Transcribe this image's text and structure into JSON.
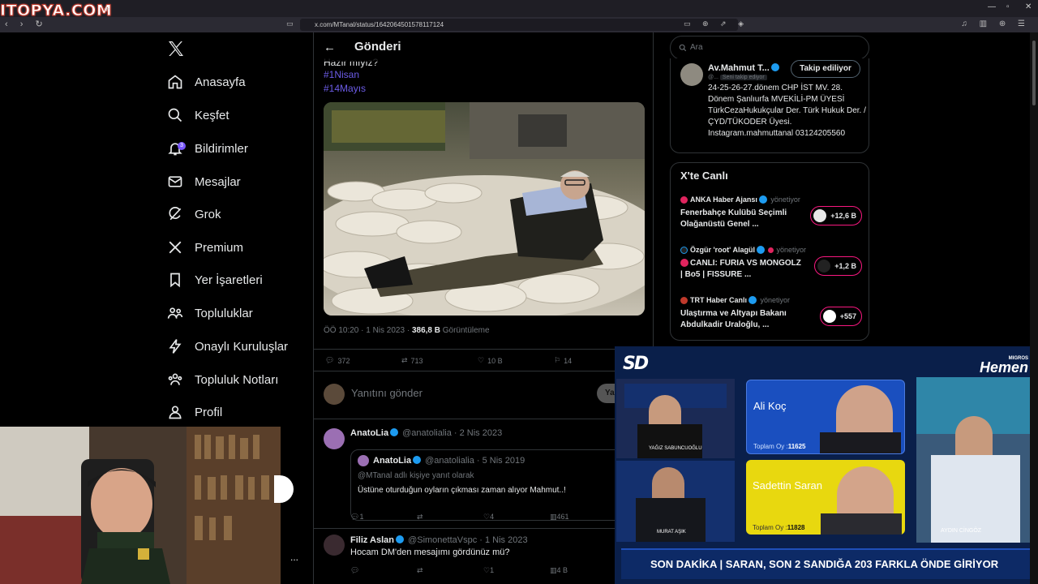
{
  "browser": {
    "watermark": "ITOPYA.COM",
    "new_tab": "+",
    "url": "x.com/MTanal/status/1642064501578117124",
    "window_controls": [
      "—",
      "▫",
      "✕"
    ]
  },
  "nav": {
    "items": [
      {
        "label": "Anasayfa",
        "icon": "home-icon"
      },
      {
        "label": "Keşfet",
        "icon": "search-icon"
      },
      {
        "label": "Bildirimler",
        "icon": "bell-icon",
        "badge": "3"
      },
      {
        "label": "Mesajlar",
        "icon": "mail-icon"
      },
      {
        "label": "Grok",
        "icon": "grok-icon"
      },
      {
        "label": "Premium",
        "icon": "x-icon"
      },
      {
        "label": "Yer İşaretleri",
        "icon": "bookmark-icon"
      },
      {
        "label": "Topluluklar",
        "icon": "communities-icon"
      },
      {
        "label": "Onaylı Kuruluşlar",
        "icon": "lightning-icon"
      },
      {
        "label": "Topluluk Notları",
        "icon": "community-notes-icon"
      },
      {
        "label": "Profil",
        "icon": "profile-icon"
      }
    ],
    "more": "..."
  },
  "post": {
    "header_title": "Gönderi",
    "cut_text": "Hazır mıyız?",
    "hashtags": [
      "#1Nisan",
      "#14Mayıs"
    ],
    "time": "ÖÖ 10:20",
    "date": "1 Nis 2023",
    "views": "386,8 B",
    "views_label": "Görüntüleme",
    "stats": {
      "replies": "372",
      "reposts": "713",
      "likes": "10 B",
      "bookmarks": "14"
    },
    "reply_placeholder": "Yanıtını gönder",
    "reply_button": "Yanıtla"
  },
  "replies": [
    {
      "name": "AnatoLia",
      "handle": "@anatolialia",
      "date": "2 Nis 2023",
      "quote": {
        "name": "AnatoLia",
        "handle": "@anatolialia",
        "date": "5 Nis 2019",
        "reply_to": "@MTanal adlı kişiye yanıt olarak",
        "text": "Üstüne oturduğun oyların çıkması zaman alıyor Mahmut..!"
      },
      "replies": "1",
      "likes": "4",
      "views": "461"
    },
    {
      "name": "Filiz Aslan",
      "handle": "@SimonettaVspc",
      "date": "1 Nis 2023",
      "text": "Hocam DM'den mesajımı gördünüz mü?",
      "replies": "",
      "likes": "1",
      "views": "4 B"
    }
  ],
  "right": {
    "search_placeholder": "Ara",
    "profile": {
      "name": "Av.Mahmut T...",
      "handle": "@...",
      "follows_you": "Seni takip ediyor",
      "follow_button": "Takip ediliyor",
      "bio": "24-25-26-27.dönem CHP İST MV. 28. Dönem Şanlıurfa MVEKİLİ-PM ÜYESİ TürkCezaHukukçular Der. Türk Hukuk Der. /ÇYD/TÜKODER Üyesi. Instagram.mahmuttanal 03124205560"
    },
    "live": {
      "title": "X'te Canlı",
      "items": [
        {
          "source": "ANKA Haber Ajansı",
          "role": "yönetiyor",
          "text": "Fenerbahçe Kulübü Seçimli Olağanüstü Genel ...",
          "count": "+12,6 B"
        },
        {
          "source": "Özgür 'root' Alagül",
          "role": "yönetiyor",
          "text": "CANLI: FURIA VS MONGOLZ | Bo5 | FISSURE ...",
          "count": "+1,2 B"
        },
        {
          "source": "TRT Haber Canlı",
          "role": "yönetiyor",
          "text": "Ulaştırma ve Altyapı Bakanı Abdulkadir Uraloğlu, ...",
          "count": "+557"
        }
      ]
    }
  },
  "stream": {
    "logo": "SD",
    "sponsor_small": "MIGROS",
    "sponsor_big": "Hemen",
    "candidates": [
      {
        "name": "Ali Koç",
        "vote_label": "Toplam Oy :",
        "votes": "11625"
      },
      {
        "name": "Sadettin Saran",
        "vote_label": "Toplam Oy :",
        "votes": "11828"
      }
    ],
    "cam_labels": [
      "YAĞIZ SABUNCUOĞLU",
      "MURAT AŞIK",
      "AYDIN CİNGÖZ"
    ],
    "ticker": "SON DAKİKA | SARAN, SON 2 SANDIĞA 203 FARKLA ÖNDE GİRİYOR"
  }
}
